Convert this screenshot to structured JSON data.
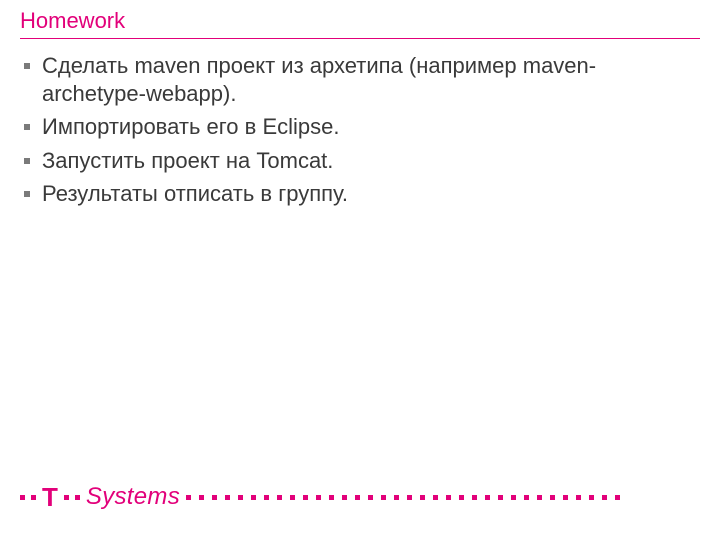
{
  "accent": "#e2007a",
  "title": "Homework",
  "bullets": [
    "Сделать maven проект из архетипа (например maven-archetype-webapp).",
    "Импортировать его в Eclipse.",
    "Запустить проект на Tomcat.",
    "Результаты отписать в группу."
  ],
  "brand": {
    "t_glyph": "T",
    "name": "Systems"
  },
  "chart_data": {
    "type": "table",
    "title": "Homework",
    "rows": [
      [
        "Сделать maven проект из архетипа (например maven-archetype-webapp)."
      ],
      [
        "Импортировать его в Eclipse."
      ],
      [
        "Запустить проект на Tomcat."
      ],
      [
        "Результаты отписать в группу."
      ]
    ]
  }
}
